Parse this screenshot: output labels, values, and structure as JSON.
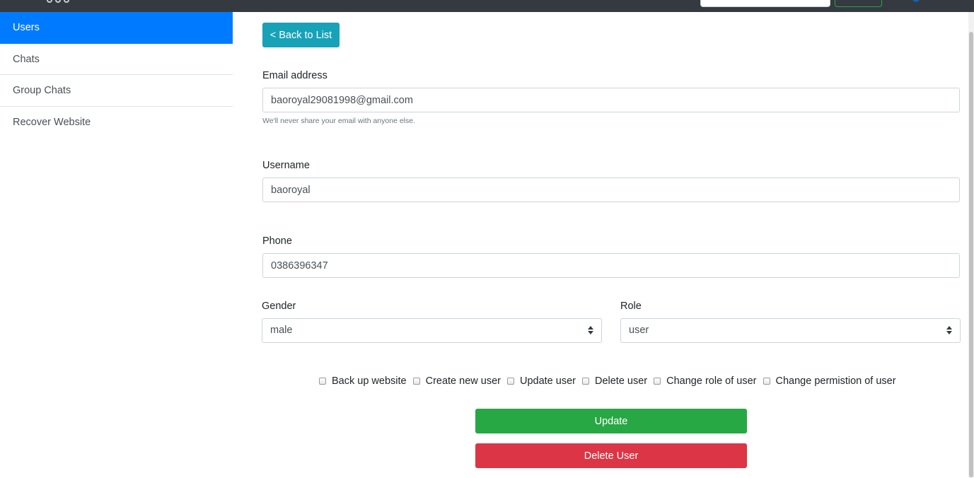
{
  "sidebar": {
    "items": [
      {
        "label": "Users",
        "active": true
      },
      {
        "label": "Chats",
        "active": false
      },
      {
        "label": "Group Chats",
        "active": false
      },
      {
        "label": "Recover Website",
        "active": false
      }
    ]
  },
  "form": {
    "back_label": "< Back to List",
    "email": {
      "label": "Email address",
      "value": "baoroyal29081998@gmail.com",
      "help": "We'll never share your email with anyone else."
    },
    "username": {
      "label": "Username",
      "value": "baoroyal"
    },
    "phone": {
      "label": "Phone",
      "value": "0386396347"
    },
    "gender": {
      "label": "Gender",
      "selected": "male"
    },
    "role": {
      "label": "Role",
      "selected": "user"
    },
    "permissions": [
      {
        "label": "Back up website",
        "checked": false
      },
      {
        "label": "Create new user",
        "checked": false
      },
      {
        "label": "Update user",
        "checked": false
      },
      {
        "label": "Delete user",
        "checked": false
      },
      {
        "label": "Change role of user",
        "checked": false
      },
      {
        "label": "Change permistion of user",
        "checked": false
      }
    ],
    "update_label": "Update",
    "delete_label": "Delete User"
  },
  "colors": {
    "active": "#007bff",
    "back_button": "#17a2b8",
    "update_button": "#28a745",
    "delete_button": "#dc3545",
    "topbar": "#343a40"
  }
}
